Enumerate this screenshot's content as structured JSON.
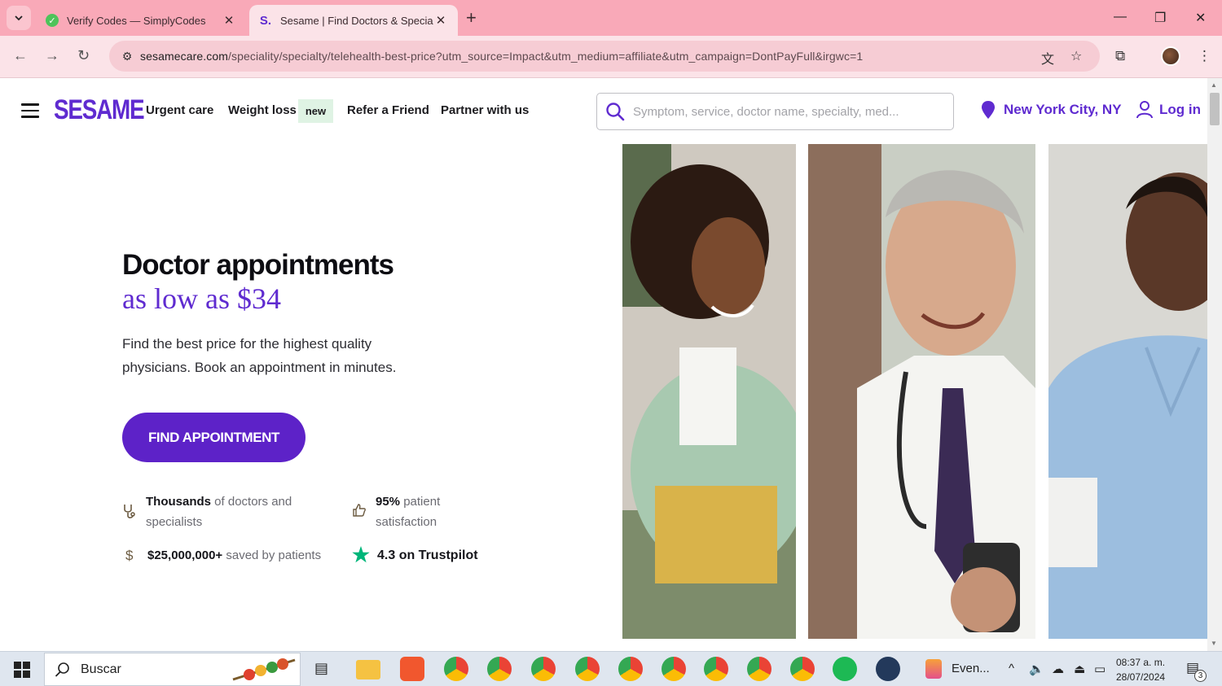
{
  "browser": {
    "tabs": [
      {
        "title": "Verify Codes — SimplyCodes",
        "active": false
      },
      {
        "title": "Sesame | Find Doctors & Specia",
        "active": true
      }
    ],
    "url_domain": "sesamecare.com",
    "url_path": "/speciality/specialty/telehealth-best-price?utm_source=Impact&utm_medium=affiliate&utm_campaign=DontPayFull&irgwc=1"
  },
  "site": {
    "logo": "SESAME",
    "nav": {
      "urgent_care": "Urgent care",
      "weight_loss": "Weight loss",
      "new_badge": "new",
      "refer": "Refer a Friend",
      "partner": "Partner with us"
    },
    "search_placeholder": "Symptom, service, doctor name, specialty, med...",
    "location": "New York City, NY",
    "login": "Log in"
  },
  "hero": {
    "title": "Doctor appointments",
    "title_accent": "as low as $34",
    "subtitle": "Find the best price for the highest quality physicians. Book an appointment in minutes.",
    "cta": "FIND APPOINTMENT"
  },
  "stats": {
    "doctors_bold": "Thousands",
    "doctors_rest": " of doctors and specialists",
    "satisfaction_bold": "95%",
    "satisfaction_rest": " patient satisfaction",
    "saved_bold": "$25,000,000+",
    "saved_rest": " saved by patients",
    "trustpilot": "4.3 on Trustpilot"
  },
  "taskbar": {
    "search_label": "Buscar",
    "event_label": "Even...",
    "time": "08:37 a. m.",
    "date": "28/07/2024",
    "notifications": "3"
  },
  "colors": {
    "brand": "#5f2bd0",
    "tab_bar": "#f9a9b8",
    "trustpilot_star": "#00b67a"
  }
}
